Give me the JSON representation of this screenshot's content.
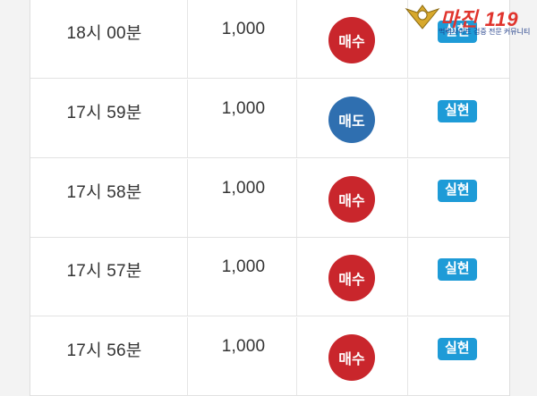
{
  "rows": [
    {
      "time": "18시 00분",
      "qty": "1,000",
      "side": "매수",
      "side_type": "buy",
      "status": "실현"
    },
    {
      "time": "17시 59분",
      "qty": "1,000",
      "side": "매도",
      "side_type": "sell",
      "status": "실현"
    },
    {
      "time": "17시 58분",
      "qty": "1,000",
      "side": "매수",
      "side_type": "buy",
      "status": "실현"
    },
    {
      "time": "17시 57분",
      "qty": "1,000",
      "side": "매수",
      "side_type": "buy",
      "status": "실현"
    },
    {
      "time": "17시 56분",
      "qty": "1,000",
      "side": "매수",
      "side_type": "buy",
      "status": "실현"
    }
  ],
  "watermark": {
    "brand": "마진 119",
    "tagline": "먹튀사이트 검증 전문 커뮤니티"
  },
  "colors": {
    "buy": "#c9262c",
    "sell": "#2f6fb0",
    "badge": "#1e9bd7"
  }
}
